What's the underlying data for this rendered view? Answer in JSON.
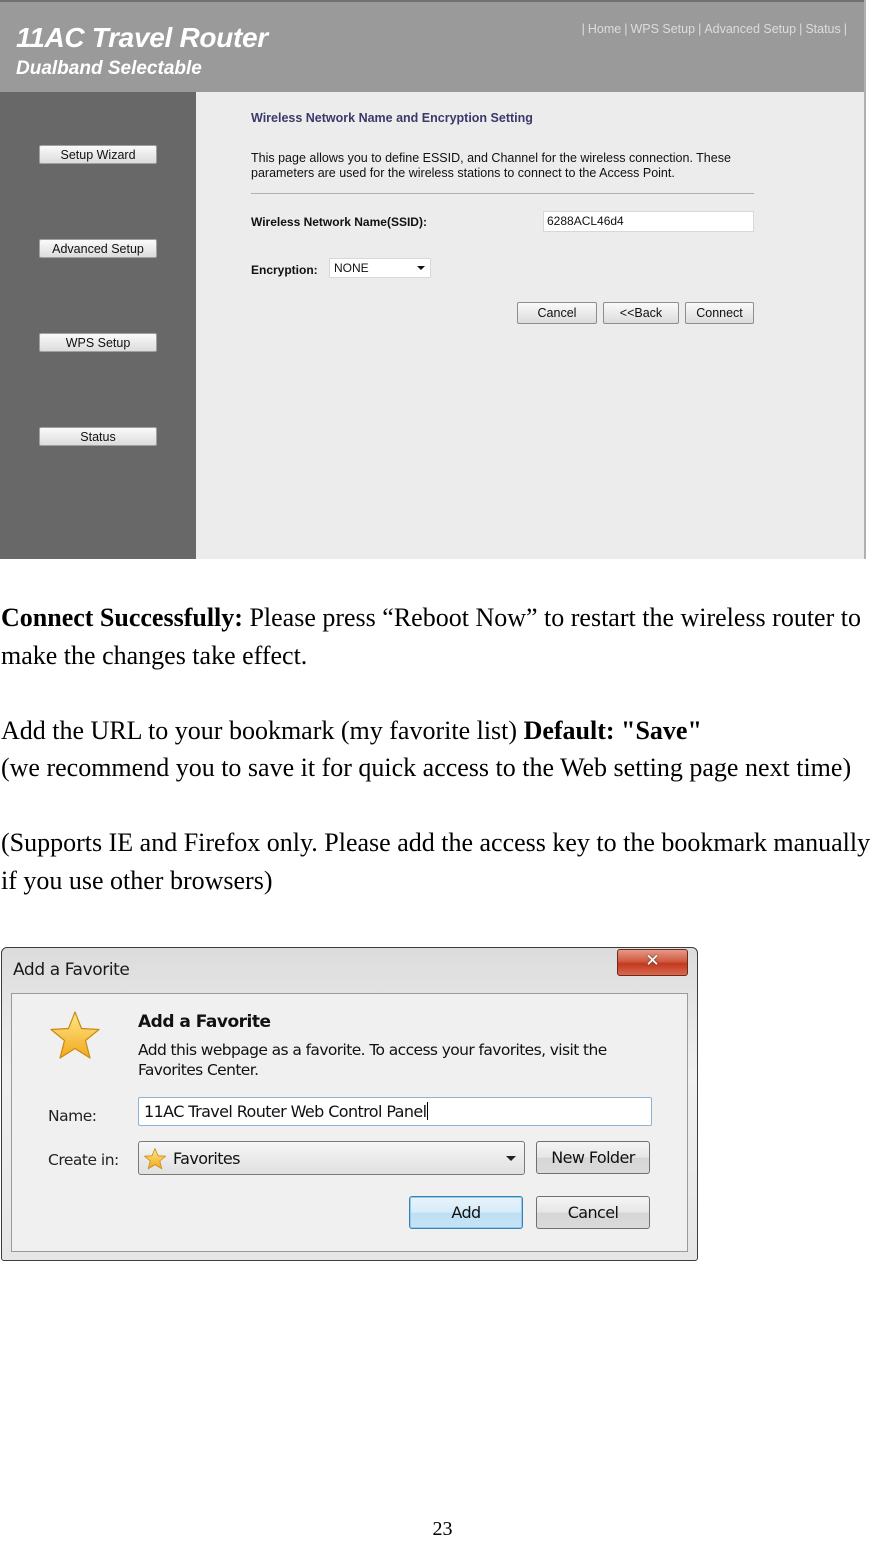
{
  "router": {
    "title": "11AC Travel Router",
    "subtitle": "Dualband Selectable",
    "top_nav": [
      "Home",
      "WPS Setup",
      "Advanced Setup",
      "Status"
    ],
    "sidebar": [
      "Setup Wizard",
      "Advanced Setup",
      "WPS Setup",
      "Status"
    ],
    "section_title": "Wireless Network Name and Encryption Setting",
    "section_desc": "This page allows you to define ESSID, and Channel for the wireless connection. These parameters are used for the wireless stations to connect to the Access Point.",
    "ssid_label": "Wireless Network Name(SSID):",
    "ssid_value": "6288ACL46d4",
    "encryption_label": "Encryption:",
    "encryption_value": "NONE",
    "buttons": {
      "cancel": "Cancel",
      "back": "<<Back",
      "connect": "Connect"
    },
    "colors": {
      "header": "#9a9a9a",
      "sidebar": "#686868",
      "content": "#ececec",
      "section_title": "#3a3a6a"
    }
  },
  "document": {
    "p1_bold": "Connect Successfully:",
    "p1_text": " Please press “Reboot Now” to restart the wireless router to make the changes take effect.",
    "p2_text": "Add the URL to your bookmark (my favorite list) ",
    "p2_bold": "Default: \"Save\"",
    "p3_text": "(we recommend you to save it for quick access to the Web setting page next time)",
    "p4_text": "(Supports IE and Firefox only. Please add the access key to the bookmark manually if you use other browsers)"
  },
  "dialog": {
    "title": "Add a Favorite",
    "close_icon": "close-icon",
    "heading": "Add a Favorite",
    "description": "Add this webpage as a favorite. To access your favorites, visit the Favorites Center.",
    "name_label": "Name:",
    "name_value": "11AC Travel Router Web Control Panel",
    "create_in_label": "Create in:",
    "create_in_value": "Favorites",
    "new_folder": "New Folder",
    "add": "Add",
    "cancel": "Cancel",
    "colors": {
      "close_button": "#c94a30",
      "add_border": "#3c7fb1",
      "star": "#f7c12c"
    }
  },
  "page_number": "23"
}
